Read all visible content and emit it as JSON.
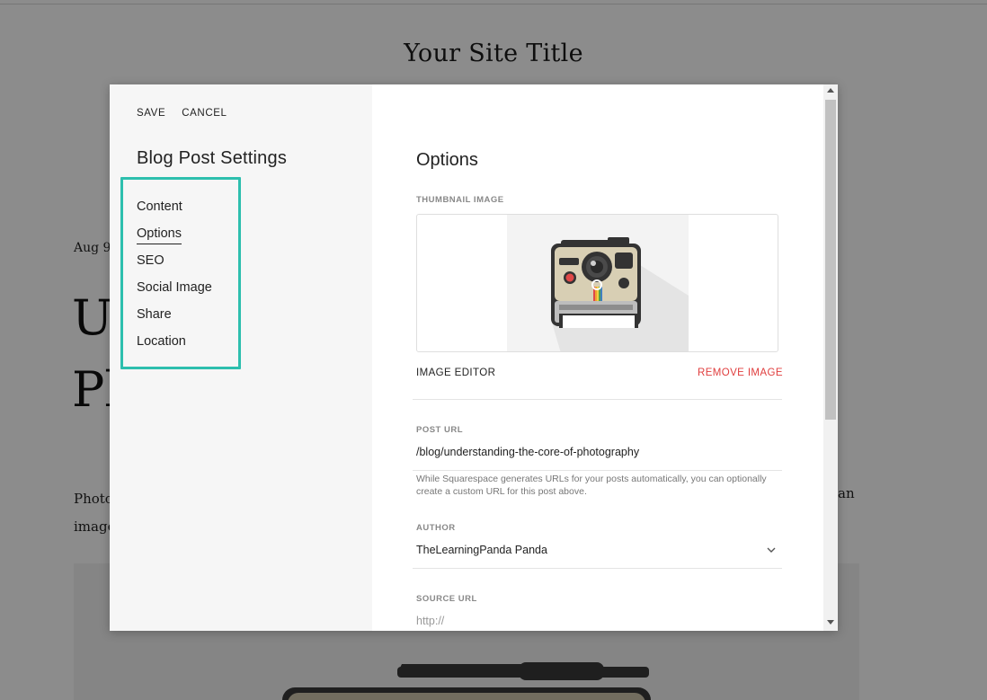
{
  "background": {
    "site_title": "Your Site Title",
    "date": "Aug 9",
    "heading_line1": "U",
    "heading_line2": "Pl",
    "para_left_line1": "Photo",
    "para_left_line2": "image",
    "para_right": "an"
  },
  "dialog": {
    "save_label": "SAVE",
    "cancel_label": "CANCEL",
    "title": "Blog Post Settings",
    "nav": {
      "items": [
        {
          "label": "Content"
        },
        {
          "label": "Options"
        },
        {
          "label": "SEO"
        },
        {
          "label": "Social Image"
        },
        {
          "label": "Share"
        },
        {
          "label": "Location"
        }
      ],
      "active": "Options",
      "highlight_color": "#2dbfae"
    },
    "options": {
      "title": "Options",
      "thumbnail_label": "THUMBNAIL IMAGE",
      "image_editor_label": "IMAGE EDITOR",
      "remove_image_label": "REMOVE IMAGE",
      "remove_color": "#e03e3e",
      "post_url_label": "POST URL",
      "post_url_value": "/blog/understanding-the-core-of-photography",
      "post_url_help": "While Squarespace generates URLs for your posts automatically, you can optionally create a custom URL for this post above.",
      "author_label": "AUTHOR",
      "author_value": "TheLearningPanda Panda",
      "source_url_label": "SOURCE URL",
      "source_url_placeholder": "http://"
    }
  }
}
